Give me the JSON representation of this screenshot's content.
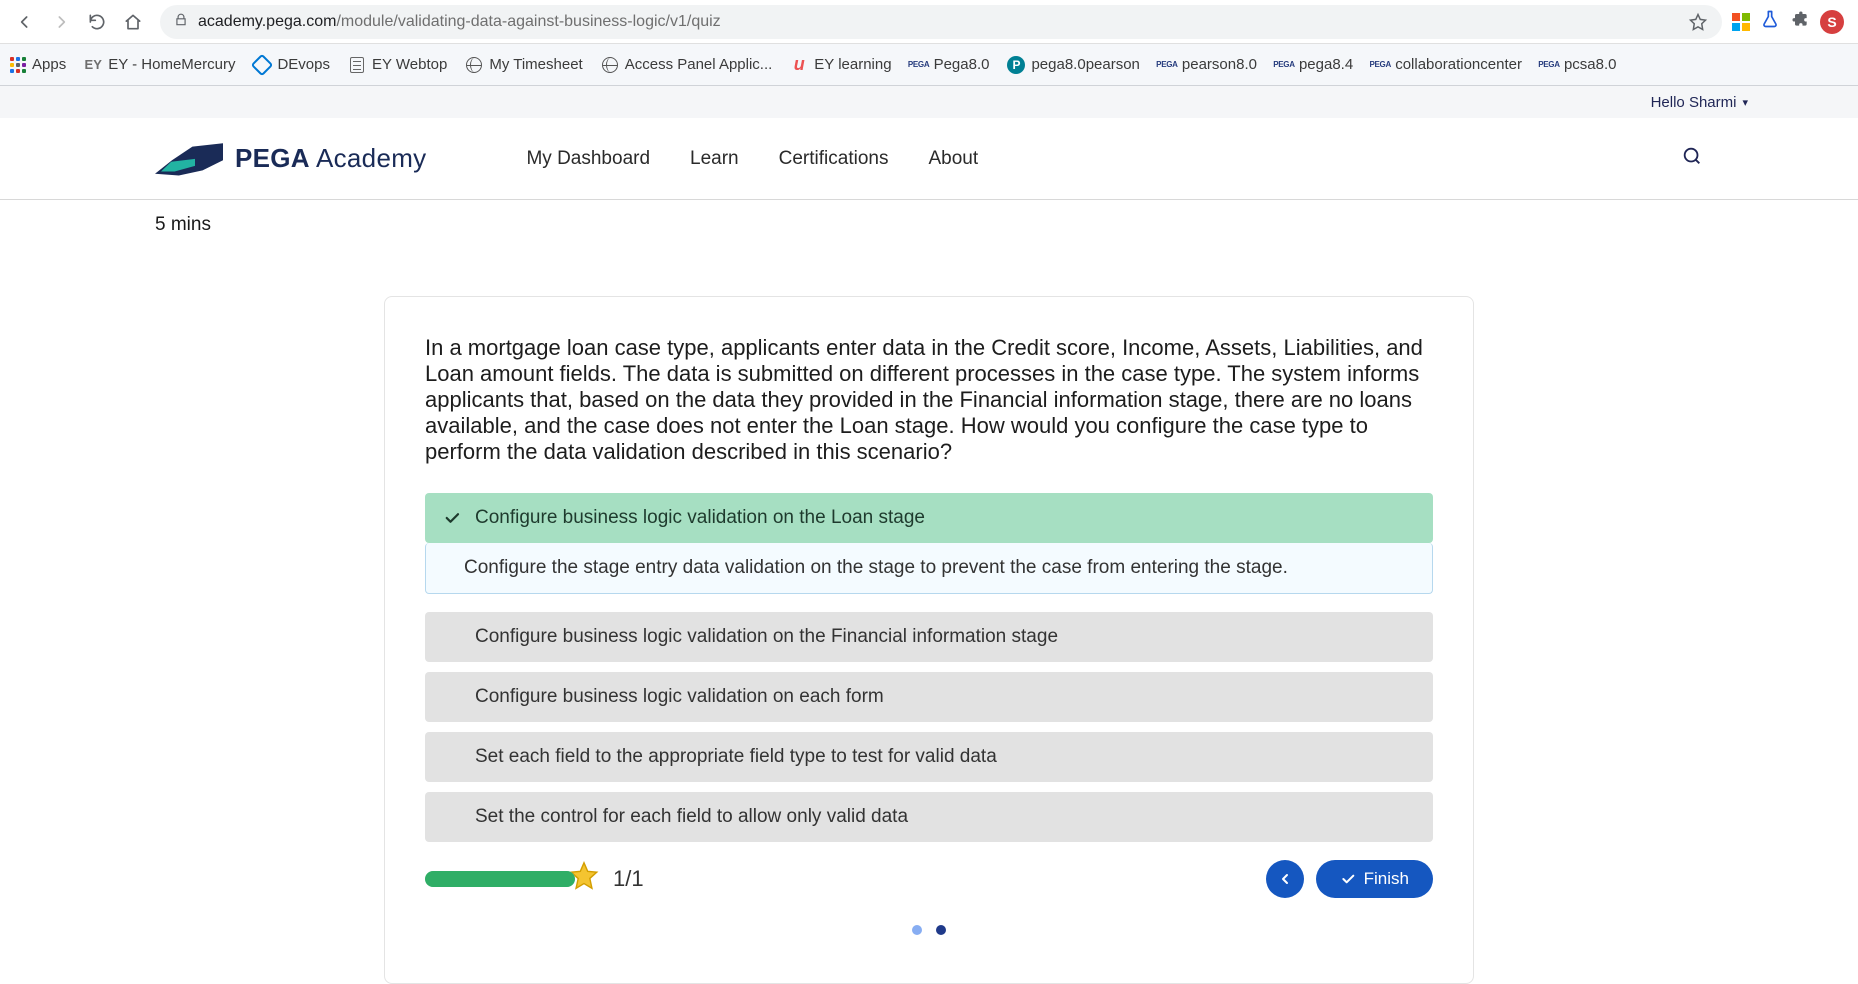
{
  "browser": {
    "url_domain": "academy.pega.com",
    "url_path": "/module/validating-data-against-business-logic/v1/quiz",
    "avatar_letter": "S"
  },
  "bookmarks": {
    "apps_label": "Apps",
    "items": [
      {
        "label": "EY - HomeMercury",
        "fav": "ey"
      },
      {
        "label": "DEvops",
        "fav": "devops"
      },
      {
        "label": "EY Webtop",
        "fav": "doc"
      },
      {
        "label": "My Timesheet",
        "fav": "globe"
      },
      {
        "label": "Access Panel Applic...",
        "fav": "globe"
      },
      {
        "label": "EY learning",
        "fav": "u"
      },
      {
        "label": "Pega8.0",
        "fav": "pega"
      },
      {
        "label": "pega8.0pearson",
        "fav": "pcircle"
      },
      {
        "label": "pearson8.0",
        "fav": "pega"
      },
      {
        "label": "pega8.4",
        "fav": "pega"
      },
      {
        "label": "collaborationcenter",
        "fav": "pega"
      },
      {
        "label": "pcsa8.0",
        "fav": "pega"
      }
    ]
  },
  "user_greeting": "Hello Sharmi",
  "site": {
    "logo_bold": "PEGA",
    "logo_light": " Academy",
    "nav": {
      "dashboard": "My Dashboard",
      "learn": "Learn",
      "certifications": "Certifications",
      "about": "About"
    }
  },
  "timer": "5 mins",
  "quiz": {
    "question": "In a mortgage loan case type, applicants enter data in the Credit score, Income, Assets, Liabilities, and Loan amount fields. The data is submitted on different processes in the case type. The system informs applicants that, based on the data they provided in the Financial information stage, there are no loans available, and the case does not enter the Loan stage. How would you configure the case type to perform the data validation described in this scenario?",
    "answers": {
      "correct": "Configure business logic validation on the Loan stage",
      "feedback": "Configure the stage entry data validation on the stage to prevent the case from entering the stage.",
      "opt2": "Configure business logic validation on the Financial information stage",
      "opt3": "Configure business logic validation on each form",
      "opt4": "Set each field to the appropriate field type to test for valid data",
      "opt5": "Set the control for each field to allow only valid data"
    },
    "score": "1/1",
    "finish_label": "Finish"
  }
}
